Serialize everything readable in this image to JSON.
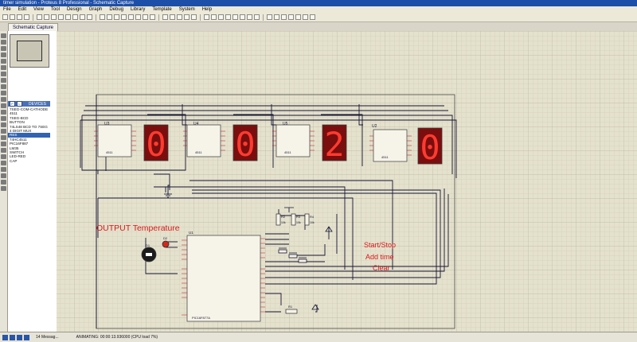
{
  "window": {
    "title": "timer simulation - Proteus 8 Professional - Schematic Capture"
  },
  "menu": [
    "File",
    "Edit",
    "View",
    "Tool",
    "Design",
    "Graph",
    "Debug",
    "Library",
    "Template",
    "System",
    "Help"
  ],
  "tab": {
    "label": "Schematic Capture"
  },
  "devices": {
    "header": "DEVICES",
    "badge_p": "P",
    "badge_l": "L",
    "items": [
      "7SEG-COM-CATHODE",
      "4511",
      "7SEG-BCD",
      "BUTTON",
      "74LS48 BCD TO 7SEG",
      "4 DIGIT MUX",
      "RES",
      "74HC4511",
      "PIC16F887",
      "LM35",
      "SWITCH",
      "LED-RED",
      "CAP"
    ],
    "selected_index": 6
  },
  "schematic": {
    "digits": [
      "0",
      "0",
      "2",
      "0"
    ],
    "ic_labels": [
      "U3",
      "U4",
      "U5",
      "U2"
    ],
    "ic_part": "4511",
    "mcu_label": "U1",
    "mcu_part": "PIC16F877A",
    "sensor_label": "D1",
    "led_label": "D2",
    "resistor_labels": [
      "R2",
      "R3",
      "R4",
      "R1"
    ],
    "resistor_values": [
      "10k",
      "10k",
      "10k",
      "10k"
    ],
    "output_label": "OUTPUT Temperature",
    "button_labels": [
      "Start/Stop",
      "Add time",
      "Clear"
    ]
  },
  "status": {
    "messages": "14 Messag...",
    "state": "ANIMATING: 00:00:13.936000 (CPU load 7%)"
  },
  "colors": {
    "accent": "#1e4fa8",
    "seg_red": "#c31111",
    "wire": "#141433",
    "label_red": "#d81a1a",
    "led": "#d3281d"
  }
}
